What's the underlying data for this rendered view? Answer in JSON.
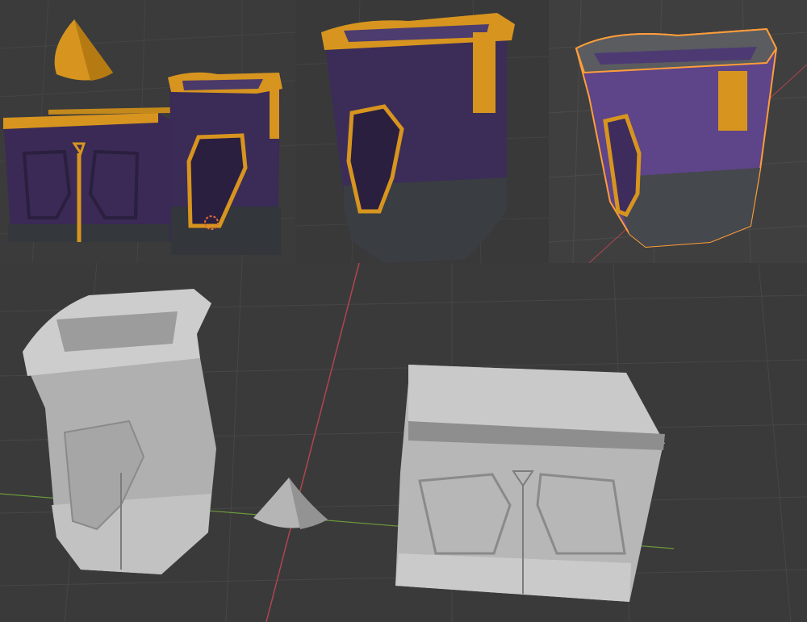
{
  "collage": {
    "panels": [
      {
        "name": "textured-pair",
        "background": "#3b3b3b"
      },
      {
        "name": "textured-tall-crate",
        "background": "#393939"
      },
      {
        "name": "selected-crate",
        "background": "#3f3f3f"
      },
      {
        "name": "untextured-sculpts",
        "background": "#3a3a3a"
      }
    ]
  },
  "materials": {
    "trim_gold": "#d7951f",
    "trim_gold_dark": "#9a6410",
    "fabric_purple": "#3e2d5c",
    "fabric_purple_dark": "#2a1f3f",
    "fabric_purple_light": "#6d4b99",
    "stone_base": "#3f4246",
    "stone_base_dark": "#2b2d30",
    "clay_light": "#c8c8c8",
    "clay_mid": "#a9a9a9",
    "clay_dark": "#7c7c7c",
    "selection_outline": "#ff9d3a",
    "axis_x": "#b0454f",
    "axis_y": "#6c9a3a",
    "grid_line": "#4a4a4a"
  }
}
